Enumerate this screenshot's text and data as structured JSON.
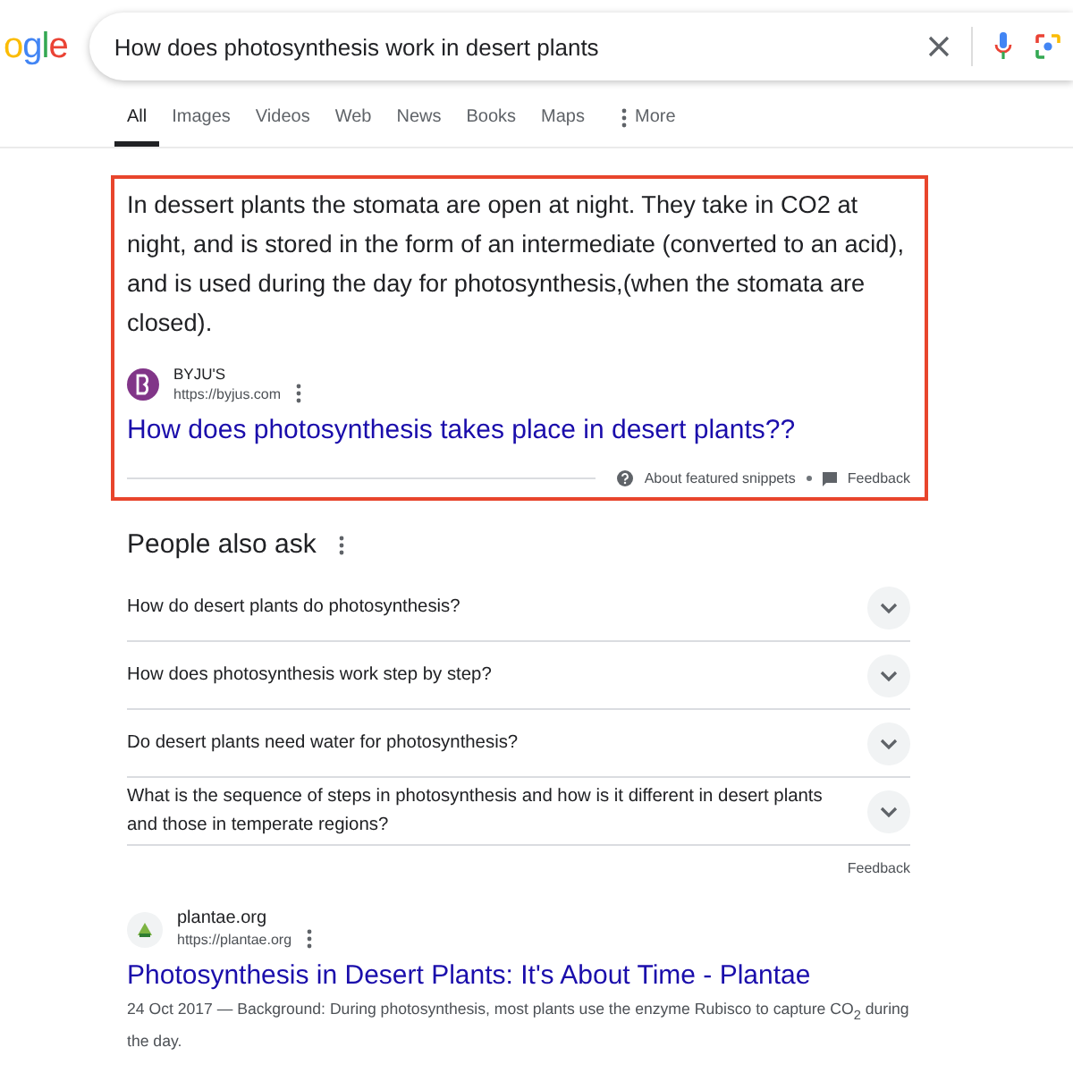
{
  "logo": {
    "letters": [
      {
        "char": "o",
        "color": "#fbbc05"
      },
      {
        "char": "g",
        "color": "#4285f4"
      },
      {
        "char": "l",
        "color": "#34a853"
      },
      {
        "char": "e",
        "color": "#ea4335"
      }
    ]
  },
  "search": {
    "value": "How does photosynthesis work in desert plants"
  },
  "tabs": [
    {
      "label": "All",
      "selected": true,
      "kind": "plain"
    },
    {
      "label": "Images",
      "selected": false,
      "kind": "plain"
    },
    {
      "label": "Videos",
      "selected": false,
      "kind": "plain"
    },
    {
      "label": "Web",
      "selected": false,
      "kind": "plain"
    },
    {
      "label": "News",
      "selected": false,
      "kind": "plain"
    },
    {
      "label": "Books",
      "selected": false,
      "kind": "plain"
    },
    {
      "label": "Maps",
      "selected": false,
      "kind": "plain"
    },
    {
      "label": "More",
      "selected": false,
      "kind": "more"
    }
  ],
  "featured_snippet": {
    "text": "In dessert plants the stomata are open at night. They take in CO2 at night, and is stored in the form of an intermediate (converted to an acid), and is used during the day for photosynthesis,(when the stomata are closed).",
    "source_name": "BYJU'S",
    "source_url": "https://byjus.com",
    "title": "How does photosynthesis takes place in desert plants??",
    "about": "About featured snippets",
    "feedback": "Feedback"
  },
  "people_also_ask": {
    "heading": "People also ask",
    "questions": [
      {
        "text": "How do desert plants do photosynthesis?",
        "expanded": false
      },
      {
        "text": "How does photosynthesis work step by step?",
        "expanded": false
      },
      {
        "text": "Do desert plants need water for photosynthesis?",
        "expanded": false
      },
      {
        "text": "What is the sequence of steps in photosynthesis and how is it different in desert plants and those in temperate regions?",
        "expanded": false
      }
    ],
    "feedback": "Feedback"
  },
  "results": [
    {
      "site": "plantae.org",
      "url": "https://plantae.org",
      "title": "Photosynthesis in Desert Plants: It's About Time - Plantae",
      "snippet": "24 Oct 2017 — Background: During photosynthesis, most plants use the enzyme Rubisco to capture CO$_{2}$ during the day."
    }
  ]
}
